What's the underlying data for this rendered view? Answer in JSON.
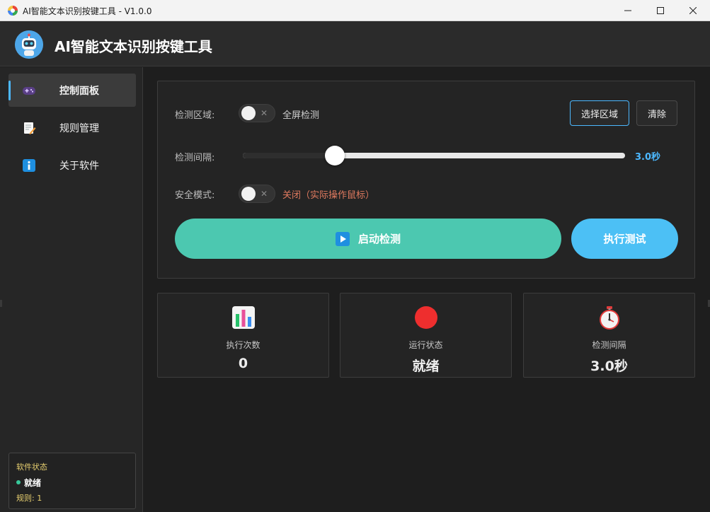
{
  "window": {
    "title": "AI智能文本识别按键工具 - V1.0.0"
  },
  "header": {
    "app_title": "AI智能文本识别按键工具"
  },
  "sidebar": {
    "items": [
      {
        "label": "控制面板",
        "icon": "gamepad-icon",
        "active": true
      },
      {
        "label": "规则管理",
        "icon": "memo-icon",
        "active": false
      },
      {
        "label": "关于软件",
        "icon": "info-icon",
        "active": false
      }
    ],
    "status": {
      "title": "软件状态",
      "value": "就绪",
      "rules": "规则: 1"
    }
  },
  "panel": {
    "region": {
      "label": "检测区域:",
      "toggle_text": "全屏检测",
      "toggle_on": false,
      "select_button": "选择区域",
      "clear_button": "清除"
    },
    "interval": {
      "label": "检测间隔:",
      "value_text": "3.0秒",
      "slider_fraction": 0.24
    },
    "safe_mode": {
      "label": "安全模式:",
      "toggle_text": "关闭（实际操作鼠标）",
      "toggle_on": false
    },
    "start_button": "启动检测",
    "test_button": "执行测试"
  },
  "stats": [
    {
      "label": "执行次数",
      "value": "0",
      "icon": "bar-chart-icon"
    },
    {
      "label": "运行状态",
      "value": "就绪",
      "icon": "red-circle-icon"
    },
    {
      "label": "检测间隔",
      "value": "3.0秒",
      "icon": "stopwatch-icon"
    }
  ],
  "colors": {
    "accent": "#4cb8ff",
    "start_button": "#4cc8b0",
    "test_button": "#4cc0f5",
    "safe_mode_off_text": "#e07a5f",
    "status_dot": "#37c89a",
    "status_text": "#e8d070"
  }
}
